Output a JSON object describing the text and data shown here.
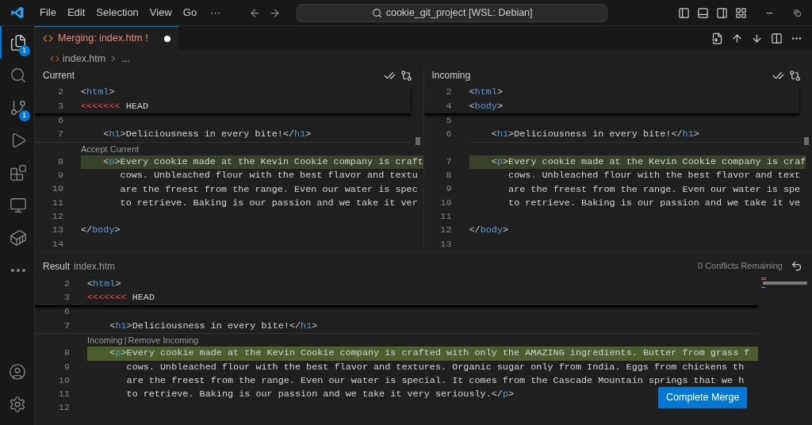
{
  "title_bar": {
    "menu": [
      "File",
      "Edit",
      "Selection",
      "View",
      "Go"
    ],
    "more": "···",
    "search": "cookie_git_project [WSL: Debian]"
  },
  "activity_bar": {
    "items": [
      {
        "kind": "files",
        "badge": "1",
        "selected": true
      },
      {
        "kind": "search",
        "selected": false
      },
      {
        "kind": "source-control",
        "badge": "1",
        "selected": false
      },
      {
        "kind": "run",
        "selected": false
      },
      {
        "kind": "extensions",
        "selected": false
      },
      {
        "kind": "remote",
        "selected": false
      },
      {
        "kind": "docker",
        "selected": false
      },
      {
        "kind": "more",
        "selected": false
      }
    ],
    "bottom": [
      {
        "kind": "account"
      },
      {
        "kind": "settings"
      }
    ]
  },
  "tab": {
    "label": "Merging: index.htm",
    "status": "!",
    "dirty": true
  },
  "breadcrumb": {
    "file": "index.htm",
    "more": "..."
  },
  "panes": [
    {
      "title": "Current",
      "lines": [
        {
          "number": "2",
          "sticky": true,
          "tokens": [
            {
              "kind": "bracket",
              "s": "<"
            },
            {
              "kind": "tag",
              "s": "html"
            },
            {
              "kind": "bracket",
              "s": ">"
            }
          ]
        },
        {
          "number": "3",
          "sticky": true,
          "tokens": [
            {
              "kind": "marker",
              "s": "<<<<<<<"
            },
            {
              "kind": "text",
              "s": " HEAD"
            }
          ]
        },
        {
          "number": "6"
        },
        {
          "number": "7",
          "tokens": [
            {
              "kind": "bracket",
              "s": "    <"
            },
            {
              "kind": "tag",
              "s": "h1"
            },
            {
              "kind": "bracket",
              "s": ">"
            },
            {
              "kind": "text",
              "s": "Deliciousness in every bite!"
            },
            {
              "kind": "bracket",
              "s": "</"
            },
            {
              "kind": "tag",
              "s": "h1"
            },
            {
              "kind": "bracket",
              "s": ">"
            }
          ]
        },
        {
          "kind": "codelens",
          "actions": [
            "Accept Current"
          ]
        },
        {
          "number": "8",
          "highlighted": true,
          "tokens": [
            {
              "kind": "bracket",
              "s": "    <"
            },
            {
              "kind": "tag",
              "s": "p"
            },
            {
              "kind": "bracket",
              "s": ">"
            },
            {
              "kind": "text",
              "s": "Every cookie made at the Kevin Cookie company is craft"
            }
          ]
        },
        {
          "number": "9",
          "tokens": [
            {
              "kind": "text",
              "s": "       cows. Unbleached flour with the best flavor and textu"
            }
          ]
        },
        {
          "number": "10",
          "tokens": [
            {
              "kind": "text",
              "s": "       are the freest from the range. Even our water is spec"
            }
          ]
        },
        {
          "number": "11",
          "tokens": [
            {
              "kind": "text",
              "s": "       to retrieve. Baking is our passion and we take it ver"
            }
          ]
        },
        {
          "number": "12"
        },
        {
          "number": "13",
          "tokens": [
            {
              "kind": "bracket",
              "s": "</"
            },
            {
              "kind": "tag",
              "s": "body"
            },
            {
              "kind": "bracket",
              "s": ">"
            }
          ]
        },
        {
          "number": "14"
        }
      ]
    },
    {
      "title": "Incoming",
      "lines": [
        {
          "number": "2",
          "sticky": true,
          "tokens": [
            {
              "kind": "bracket",
              "s": "<"
            },
            {
              "kind": "tag",
              "s": "html"
            },
            {
              "kind": "bracket",
              "s": ">"
            }
          ]
        },
        {
          "number": "4",
          "sticky": true,
          "tokens": [
            {
              "kind": "bracket",
              "s": "<"
            },
            {
              "kind": "tag",
              "s": "body"
            },
            {
              "kind": "bracket",
              "s": ">"
            }
          ]
        },
        {
          "number": "5"
        },
        {
          "number": "6",
          "tokens": [
            {
              "kind": "bracket",
              "s": "    <"
            },
            {
              "kind": "tag",
              "s": "h1"
            },
            {
              "kind": "bracket",
              "s": ">"
            },
            {
              "kind": "text",
              "s": "Deliciousness in every bite!"
            },
            {
              "kind": "bracket",
              "s": "</"
            },
            {
              "kind": "tag",
              "s": "h1"
            },
            {
              "kind": "bracket",
              "s": ">"
            }
          ]
        },
        {
          "kind": "spacer"
        },
        {
          "number": "7",
          "highlighted": true,
          "tokens": [
            {
              "kind": "bracket",
              "s": "    <"
            },
            {
              "kind": "tag",
              "s": "p"
            },
            {
              "kind": "bracket",
              "s": ">"
            },
            {
              "kind": "text",
              "s": "Every cookie made at the Kevin Cookie company is craf"
            }
          ]
        },
        {
          "number": "8",
          "tokens": [
            {
              "kind": "text",
              "s": "       cows. Unbleached flour with the best flavor and text"
            }
          ]
        },
        {
          "number": "9",
          "tokens": [
            {
              "kind": "text",
              "s": "       are the freest from the range. Even our water is spe"
            }
          ]
        },
        {
          "number": "10",
          "tokens": [
            {
              "kind": "text",
              "s": "       to retrieve. Baking is our passion and we take it ve"
            }
          ]
        },
        {
          "number": "11"
        },
        {
          "number": "12",
          "tokens": [
            {
              "kind": "bracket",
              "s": "</"
            },
            {
              "kind": "tag",
              "s": "body"
            },
            {
              "kind": "bracket",
              "s": ">"
            }
          ]
        },
        {
          "number": "13"
        }
      ]
    }
  ],
  "result": {
    "title": "Result",
    "file": "index.htm",
    "conflicts": "0 Conflicts Remaining",
    "button": "Complete Merge",
    "lines": [
      {
        "number": "2",
        "sticky": true,
        "tokens": [
          {
            "kind": "bracket",
            "s": "<"
          },
          {
            "kind": "tag",
            "s": "html"
          },
          {
            "kind": "bracket",
            "s": ">"
          }
        ]
      },
      {
        "number": "3",
        "sticky": true,
        "tokens": [
          {
            "kind": "marker",
            "s": "<<<<<<<"
          },
          {
            "kind": "text",
            "s": " HEAD"
          }
        ]
      },
      {
        "number": "6"
      },
      {
        "number": "7",
        "tokens": [
          {
            "kind": "bracket",
            "s": "    <"
          },
          {
            "kind": "tag",
            "s": "h1"
          },
          {
            "kind": "bracket",
            "s": ">"
          },
          {
            "kind": "text",
            "s": "Deliciousness in every bite!"
          },
          {
            "kind": "bracket",
            "s": "</"
          },
          {
            "kind": "tag",
            "s": "h1"
          },
          {
            "kind": "bracket",
            "s": ">"
          }
        ]
      },
      {
        "kind": "codelens",
        "actions": [
          "Incoming",
          "Remove Incoming"
        ],
        "separator": "|"
      },
      {
        "number": "8",
        "highlighted": true,
        "tokens": [
          {
            "kind": "bracket",
            "s": "    <"
          },
          {
            "kind": "tag",
            "s": "p"
          },
          {
            "kind": "bracket",
            "s": ">"
          },
          {
            "kind": "text",
            "s": "Every cookie made at the Kevin Cookie company is crafted with only the AMAZING ingredients. Butter from grass f"
          }
        ]
      },
      {
        "number": "9",
        "tokens": [
          {
            "kind": "text",
            "s": "       cows. Unbleached flour with the best flavor and textures. Organic sugar only from India. Eggs from chickens th"
          }
        ]
      },
      {
        "number": "10",
        "tokens": [
          {
            "kind": "text",
            "s": "       are the freest from the range. Even our water is special. It comes from the Cascade Mountain springs that we h"
          }
        ]
      },
      {
        "number": "11",
        "tokens": [
          {
            "kind": "text",
            "s": "       to retrieve. Baking is our passion and we take it very seriously."
          },
          {
            "kind": "bracket",
            "s": "</"
          },
          {
            "kind": "tag",
            "s": "p"
          },
          {
            "kind": "bracket",
            "s": ">"
          }
        ]
      },
      {
        "number": "12"
      }
    ]
  }
}
